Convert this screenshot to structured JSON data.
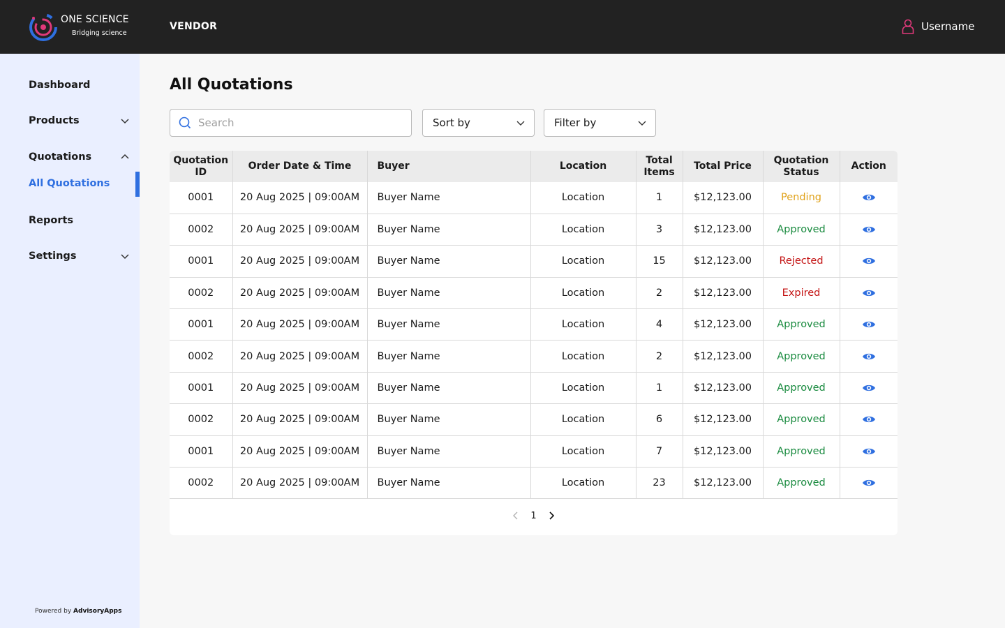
{
  "header": {
    "logo_title": "ONE SCIENCE",
    "logo_subtitle": "Bridging science",
    "role": "VENDOR",
    "username": "Username"
  },
  "sidebar": {
    "items": [
      {
        "label": "Dashboard"
      },
      {
        "label": "Products"
      },
      {
        "label": "Quotations"
      },
      {
        "label": "All Quotations"
      },
      {
        "label": "Reports"
      },
      {
        "label": "Settings"
      }
    ],
    "powered_prefix": "Powered by",
    "powered_brand": "AdvisoryApps"
  },
  "main": {
    "title": "All Quotations",
    "search_placeholder": "Search",
    "sort_label": "Sort by",
    "filter_label": "Filter by"
  },
  "table": {
    "headers": {
      "id": "Quotation ID",
      "date": "Order Date & Time",
      "buyer": "Buyer",
      "location": "Location",
      "items": "Total Items",
      "price": "Total Price",
      "status": "Quotation Status",
      "action": "Action"
    },
    "rows": [
      {
        "id": "0001",
        "date": "20 Aug 2025 | 09:00AM",
        "buyer": "Buyer Name",
        "location": "Location",
        "items": "1",
        "price": "$12,123.00",
        "status": "Pending"
      },
      {
        "id": "0002",
        "date": "20 Aug 2025 | 09:00AM",
        "buyer": "Buyer Name",
        "location": "Location",
        "items": "3",
        "price": "$12,123.00",
        "status": "Approved"
      },
      {
        "id": "0001",
        "date": "20 Aug 2025 | 09:00AM",
        "buyer": "Buyer Name",
        "location": "Location",
        "items": "15",
        "price": "$12,123.00",
        "status": "Rejected"
      },
      {
        "id": "0002",
        "date": "20 Aug 2025 | 09:00AM",
        "buyer": "Buyer Name",
        "location": "Location",
        "items": "2",
        "price": "$12,123.00",
        "status": "Expired"
      },
      {
        "id": "0001",
        "date": "20 Aug 2025 | 09:00AM",
        "buyer": "Buyer Name",
        "location": "Location",
        "items": "4",
        "price": "$12,123.00",
        "status": "Approved"
      },
      {
        "id": "0002",
        "date": "20 Aug 2025 | 09:00AM",
        "buyer": "Buyer Name",
        "location": "Location",
        "items": "2",
        "price": "$12,123.00",
        "status": "Approved"
      },
      {
        "id": "0001",
        "date": "20 Aug 2025 | 09:00AM",
        "buyer": "Buyer Name",
        "location": "Location",
        "items": "1",
        "price": "$12,123.00",
        "status": "Approved"
      },
      {
        "id": "0002",
        "date": "20 Aug 2025 | 09:00AM",
        "buyer": "Buyer Name",
        "location": "Location",
        "items": "6",
        "price": "$12,123.00",
        "status": "Approved"
      },
      {
        "id": "0001",
        "date": "20 Aug 2025 | 09:00AM",
        "buyer": "Buyer Name",
        "location": "Location",
        "items": "7",
        "price": "$12,123.00",
        "status": "Approved"
      },
      {
        "id": "0002",
        "date": "20 Aug 2025 | 09:00AM",
        "buyer": "Buyer Name",
        "location": "Location",
        "items": "23",
        "price": "$12,123.00",
        "status": "Approved"
      }
    ],
    "action_icon": "eye-icon"
  },
  "pagination": {
    "current_page": "1"
  },
  "colors": {
    "topbar": "#222222",
    "sidebar": "#eaefff",
    "accent": "#2f6fe0",
    "pending": "#e0a21a",
    "approved": "#188a3e",
    "rejected": "#c41414",
    "expired": "#c41414",
    "user_icon": "#e0397a"
  }
}
